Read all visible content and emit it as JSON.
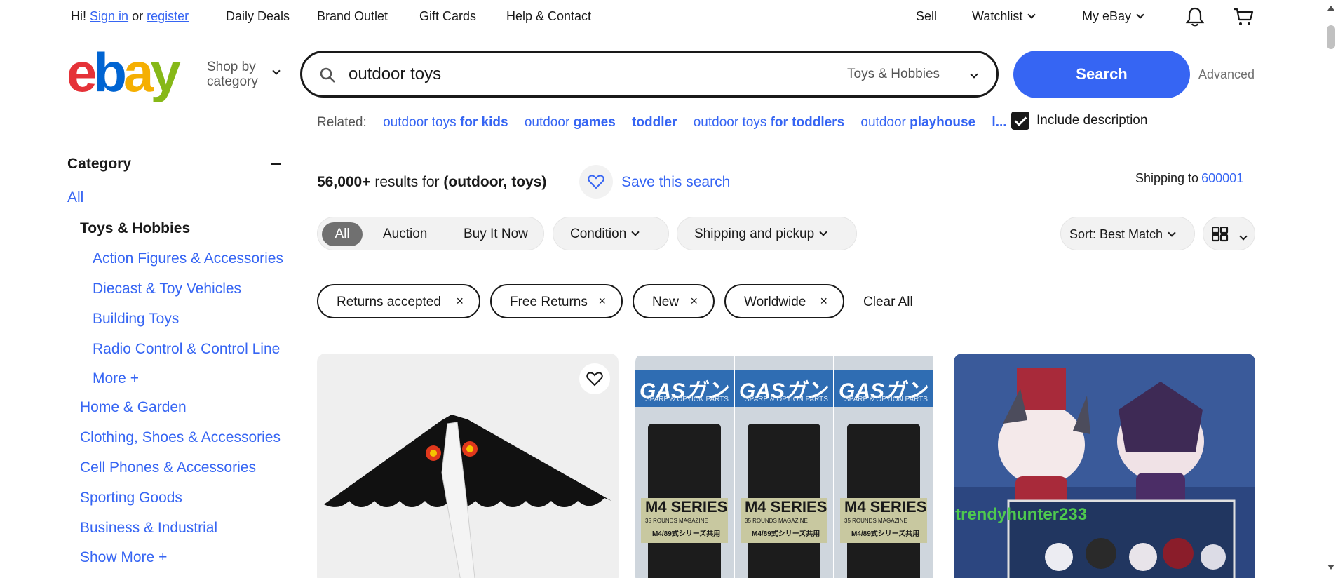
{
  "topbar": {
    "greeting": "Hi!",
    "sign_in": "Sign in",
    "or": "or",
    "register": "register",
    "links": [
      "Daily Deals",
      "Brand Outlet",
      "Gift Cards",
      "Help & Contact"
    ],
    "sell": "Sell",
    "watchlist": "Watchlist",
    "my_ebay": "My eBay"
  },
  "header": {
    "logo": {
      "letters": [
        "e",
        "b",
        "a",
        "y"
      ],
      "colors": [
        "#e53238",
        "#0064d2",
        "#f5af02",
        "#86b817"
      ]
    },
    "shop_by_line1": "Shop by",
    "shop_by_line2": "category",
    "search": {
      "value": "outdoor toys",
      "category": "Toys & Hobbies",
      "button": "Search",
      "advanced": "Advanced"
    }
  },
  "related": {
    "label": "Related:",
    "items": [
      {
        "normal": "outdoor toys",
        "bold": "for kids"
      },
      {
        "normal": "outdoor",
        "bold": "games"
      },
      {
        "normal": "",
        "bold": "toddler"
      },
      {
        "normal": "outdoor toys",
        "bold": "for toddlers"
      },
      {
        "normal": "outdoor",
        "bold": "playhouse"
      },
      {
        "normal": "l...",
        "bold": ""
      }
    ],
    "include_description": "Include description"
  },
  "sidebar": {
    "category_heading": "Category",
    "all": "All",
    "selected": "Toys & Hobbies",
    "subcategories": [
      "Action Figures & Accessories",
      "Diecast & Toy Vehicles",
      "Building Toys",
      "Radio Control & Control Line"
    ],
    "more": "More",
    "categories": [
      "Home & Garden",
      "Clothing, Shoes & Accessories",
      "Cell Phones & Accessories",
      "Sporting Goods",
      "Business & Industrial"
    ],
    "show_more": "Show More"
  },
  "results": {
    "count": "56,000+",
    "text": "results for",
    "query": "(outdoor, toys)",
    "save_search": "Save this search",
    "shipping_to": "Shipping to",
    "zip": "600001"
  },
  "filters": {
    "buying_formats": [
      "All",
      "Auction",
      "Buy It Now"
    ],
    "condition": "Condition",
    "shipping": "Shipping and pickup",
    "sort": "Sort: Best Match"
  },
  "chips": [
    "Returns accepted",
    "Free Returns",
    "New",
    "Worldwide"
  ],
  "chip_remove": "×",
  "clear_all": "Clear All",
  "products": {
    "card2": {
      "line1": "GASガン",
      "line2": "SPARE & OPTION PARTS",
      "series": "M4 SERIES",
      "sub": "35 ROUNDS",
      "sub2": "MAGAZINE",
      "sub3": "M4/89式シリーズ共用"
    },
    "card3": {
      "watermark": "trendyhunter233"
    }
  },
  "colors": {
    "accent": "#3665f3",
    "text": "#191919"
  }
}
